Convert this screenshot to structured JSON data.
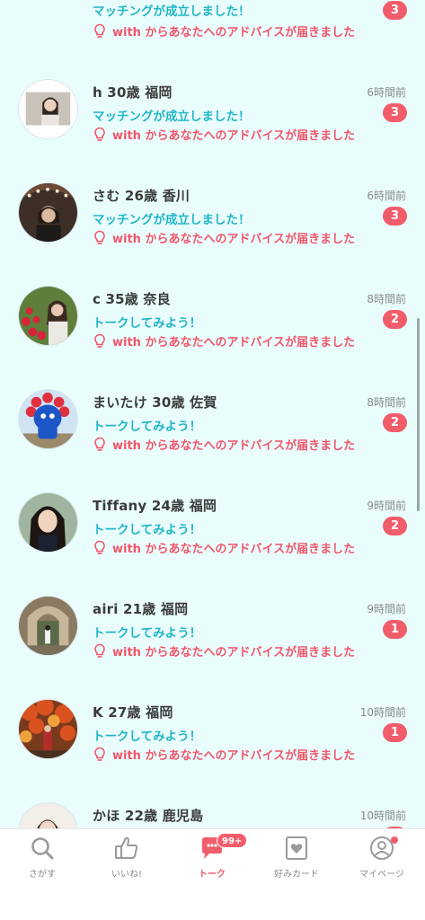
{
  "conversations": [
    {
      "name": "",
      "time": "",
      "message": "マッチングが成立しました！",
      "advice": "with からあなたへのアドバイスが届きました",
      "unread": "3"
    },
    {
      "name": "h 30歳 福岡",
      "time": "6時間前",
      "message": "マッチングが成立しました！",
      "advice": "with からあなたへのアドバイスが届きました",
      "unread": "3"
    },
    {
      "name": "さむ 26歳 香川",
      "time": "6時間前",
      "message": "マッチングが成立しました！",
      "advice": "with からあなたへのアドバイスが届きました",
      "unread": "3"
    },
    {
      "name": "c 35歳 奈良",
      "time": "8時間前",
      "message": "トークしてみよう！",
      "advice": "with からあなたへのアドバイスが届きました",
      "unread": "2"
    },
    {
      "name": "まいたけ 30歳 佐賀",
      "time": "8時間前",
      "message": "トークしてみよう！",
      "advice": "with からあなたへのアドバイスが届きました",
      "unread": "2"
    },
    {
      "name": "Tiffany  24歳 福岡",
      "time": "9時間前",
      "message": "トークしてみよう！",
      "advice": "with からあなたへのアドバイスが届きました",
      "unread": "2"
    },
    {
      "name": "airi 21歳 福岡",
      "time": "9時間前",
      "message": "トークしてみよう！",
      "advice": "with からあなたへのアドバイスが届きました",
      "unread": "1"
    },
    {
      "name": "K 27歳 福岡",
      "time": "10時間前",
      "message": "トークしてみよう！",
      "advice": "with からあなたへのアドバイスが届きました",
      "unread": "1"
    },
    {
      "name": "かほ 22歳 鹿児島",
      "time": "10時間前",
      "message": "",
      "advice": "",
      "unread": ""
    }
  ],
  "tabbar": {
    "search": "さがす",
    "likes": "いいね!",
    "talk": "トーク",
    "talk_badge": "99+",
    "cards": "好みカード",
    "mypage": "マイページ"
  },
  "colors": {
    "background": "#eafdfd",
    "accent_pink": "#f25d6b",
    "accent_teal": "#22b6c7"
  }
}
